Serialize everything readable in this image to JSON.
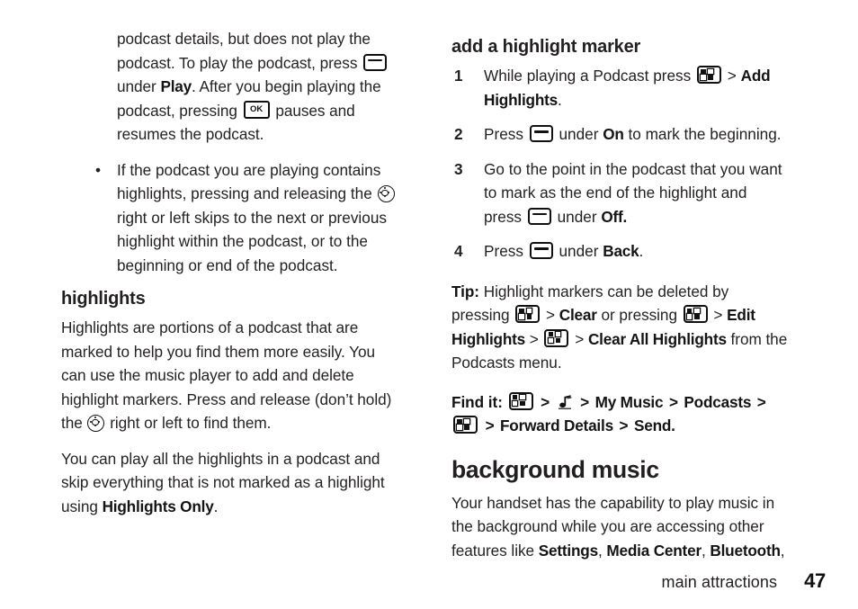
{
  "left_column": {
    "intro_paragraph": {
      "t1": "podcast details, but does not play the podcast. To play the podcast, press ",
      "t2": " under ",
      "softkey_label": "Play",
      "t3": ". After you begin playing the podcast, pressing ",
      "ok_label": "OK",
      "t4": " pauses and resumes the podcast."
    },
    "bullet": {
      "marker": "•",
      "t1": "If the podcast you are playing contains highlights, pressing and releasing the ",
      "t2": " right or left skips to the next or previous highlight within the podcast, or to the beginning or end of the podcast."
    },
    "highlights_heading": "highlights",
    "highlights_paragraph": {
      "t1": "Highlights are portions of a podcast that are marked to help you find them more easily. You can use the music player to add and delete highlight markers. Press and release (don’t hold) the ",
      "t2": " right or left to find them."
    },
    "highlights_only_paragraph": {
      "t1": "You can play all the highlights in a podcast and skip everything that is not marked as a highlight using ",
      "menu_item": "Highlights Only",
      "t2": "."
    }
  },
  "right_column": {
    "add_marker_heading": "add a highlight marker",
    "steps": [
      {
        "num": "1",
        "t1": "While playing a Podcast press ",
        "t2": " > ",
        "menu_item": "Add Highlights",
        "t3": "."
      },
      {
        "num": "2",
        "t1": "Press ",
        "t2": " under ",
        "menu_item": "On",
        "t3": " to mark the beginning."
      },
      {
        "num": "3",
        "t1": "Go to the point in the podcast that you want to mark as the end of the highlight and press ",
        "t2": " under ",
        "menu_item": "Off.",
        "t3": ""
      },
      {
        "num": "4",
        "t1": "Press ",
        "t2": " under ",
        "menu_item": "Back",
        "t3": "."
      }
    ],
    "tip": {
      "lead": "Tip:",
      "t1": " Highlight markers can be deleted by pressing ",
      "t2": " > ",
      "mi1": "Clear",
      "t3": " or pressing ",
      "t4": " > ",
      "mi2": "Edit Highlights",
      "t5": " > ",
      "t6": " > ",
      "mi3": "Clear All Highlights",
      "t7": " from the Podcasts menu."
    },
    "find_it": {
      "lead": "Find it:",
      "sep1": " > ",
      "sep2": " > ",
      "mi1": "My Music",
      "sep3": " > ",
      "mi2": "Podcasts",
      "sep4": " > ",
      "sep5": " > ",
      "mi3": "Forward Details",
      "sep6": " > ",
      "mi4": "Send."
    },
    "background_music_heading": "background music",
    "background_music_paragraph": {
      "t1": "Your handset has the capability to play music in the background while you are accessing other features like ",
      "mi1": "Settings",
      "sep1": ", ",
      "mi2": "Media Center",
      "sep2": ", ",
      "mi3": "Bluetooth",
      "sep3": ","
    }
  },
  "footer": {
    "section_name": "main attractions",
    "page_number": "47"
  }
}
